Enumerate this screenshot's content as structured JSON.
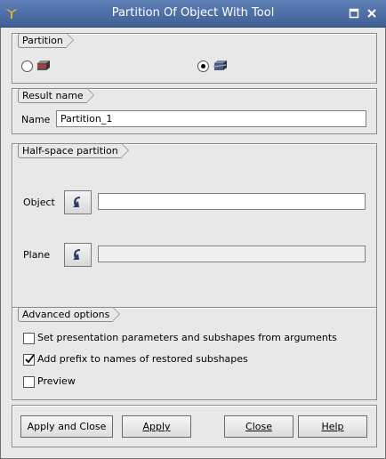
{
  "window": {
    "title": "Partition Of Object With Tool"
  },
  "partition": {
    "title": "Partition",
    "selected": 1
  },
  "result": {
    "title": "Result name",
    "name_label": "Name",
    "name_value": "Partition_1"
  },
  "halfspace": {
    "title": "Half-space partition",
    "object_label": "Object",
    "object_value": "",
    "plane_label": "Plane",
    "plane_value": ""
  },
  "advanced": {
    "title": "Advanced options",
    "options": [
      {
        "label": "Set presentation parameters and subshapes from arguments",
        "checked": false
      },
      {
        "label": "Add prefix to names of restored subshapes",
        "checked": true
      },
      {
        "label": "Preview",
        "checked": false
      }
    ]
  },
  "buttons": {
    "apply_close": "Apply and Close",
    "apply": "Apply",
    "close": "Close",
    "help": "Help"
  },
  "colors": {
    "titlebar": "#4a6aa0",
    "background": "#e8e8e8"
  }
}
